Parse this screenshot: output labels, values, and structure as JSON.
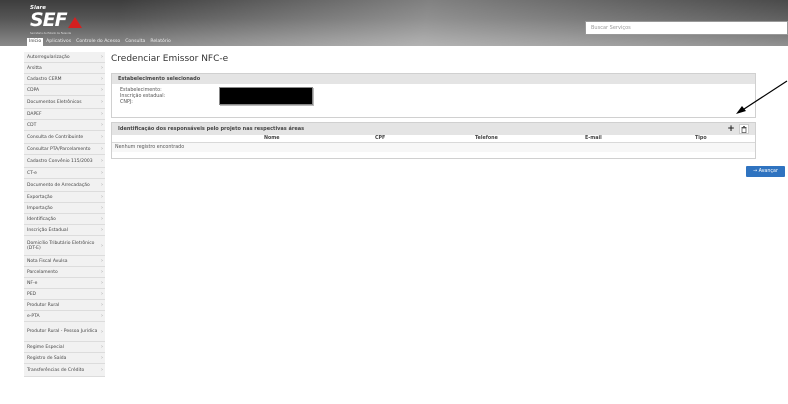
{
  "header": {
    "logo_small": "Siare",
    "logo_main": "SEF",
    "logo_sub": "Secretaria de Estado de Fazenda",
    "search_placeholder": "Buscar Serviços",
    "menu": [
      "Início",
      "Aplicativos",
      "Controle do Acesso",
      "Consulta",
      "Relatório"
    ],
    "menu_active_index": 0
  },
  "sidebar": {
    "items": [
      "Autorregularização",
      "Arsitta",
      "Cadastro CERM",
      "CDPA",
      "Documentos Eletrônicos",
      "DAPEF",
      "CDT",
      "Consulta de Contribuinte",
      "Consultar PTA/Parcelamento",
      "Cadastro Convênio 115/2003",
      "CT-e",
      "Documento de Arrecadação",
      "Exportação",
      "Importação",
      "Identificação",
      "Inscrição Estadual",
      "Domicílio Tributário Eletrônico (DT-E)",
      "Nota Fiscal Avulsa",
      "Parcelamento",
      "NF-e",
      "PED",
      "Produtor Rural",
      "e-PTA",
      "Produtor Rural - Pessoa Jurídica",
      "Regime Especial",
      "Registro de Saída",
      "Transferências de Crédito"
    ]
  },
  "main": {
    "title": "Credenciar Emissor NFC-e",
    "establishment": {
      "heading": "Estabelecimento selecionado",
      "labels": [
        "Estabelecimento:",
        "Inscrição estadual:",
        "CNPJ:"
      ]
    },
    "responsibles": {
      "heading": "Identificação dos responsáveis pelo projeto nas respectivas áreas",
      "add_symbol": "+",
      "delete_symbol": "🗑",
      "columns": [
        "Nome",
        "CPF",
        "Telefone",
        "E-mail",
        "Tipo"
      ],
      "empty_message": "Nenhum registro encontrado"
    },
    "advance_label": "→ Avançar"
  },
  "colors": {
    "header_dark": "#3d3d3d",
    "logo_red": "#d42020",
    "panel_head": "#e4e4e4",
    "button_blue": "#2f73c0"
  }
}
